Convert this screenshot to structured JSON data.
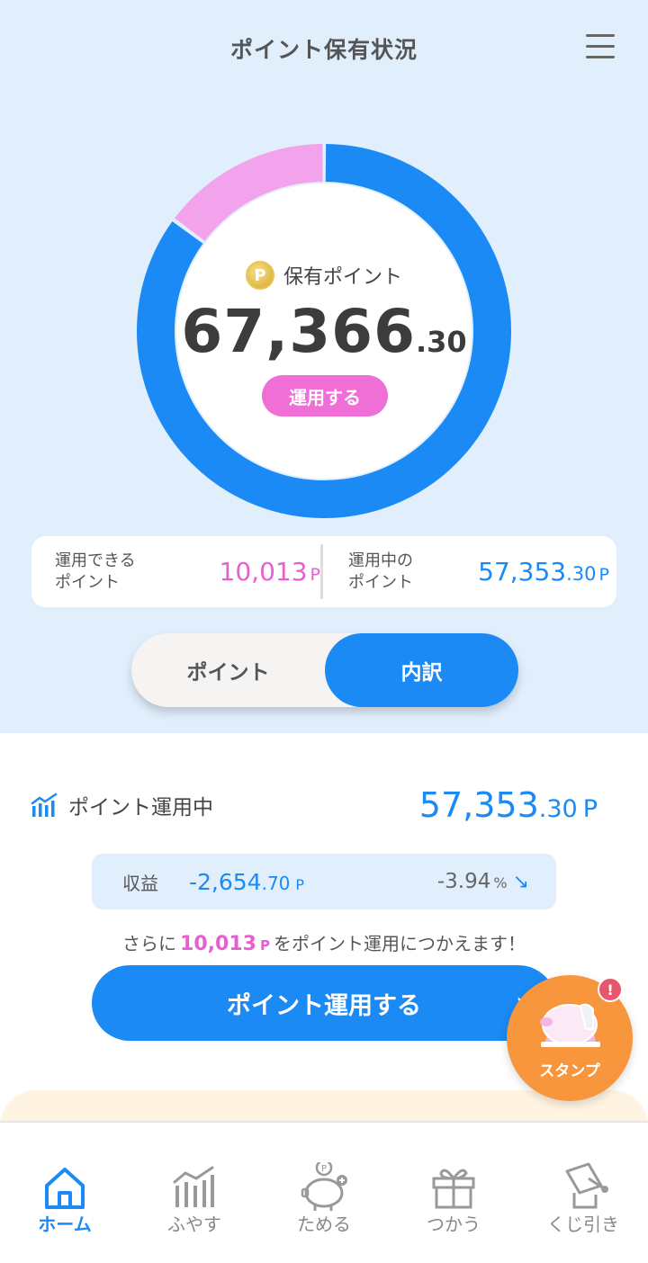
{
  "header": {
    "title": "ポイント保有状況",
    "menu_icon": "hamburger-menu-icon"
  },
  "holdings": {
    "label": "保有ポイント",
    "coin_symbol": "P",
    "amount_int": "67,366",
    "amount_dec": ".30",
    "invest_button": "運用する",
    "donut": {
      "available_fraction": 0.149,
      "invested_fraction": 0.851,
      "available_color": "#f3a3ec",
      "invested_color": "#1b8af5"
    }
  },
  "summary": {
    "available_label_1": "運用できる",
    "available_label_2": "ポイント",
    "available_value": "10,013",
    "available_unit": "P",
    "invested_label_1": "運用中の",
    "invested_label_2": "ポイント",
    "invested_value": "57,353",
    "invested_dec": ".30",
    "invested_unit": "P"
  },
  "toggle": {
    "left": "ポイント",
    "right": "内訳",
    "selected": "内訳"
  },
  "investment": {
    "title": "ポイント運用中",
    "icon": "chart-bars-icon",
    "total_int": "57,353",
    "total_dec": ".30",
    "total_unit": "P",
    "profit_label": "収益",
    "profit_int": "-2,654",
    "profit_dec": ".70",
    "profit_unit": "P",
    "profit_pct": "-3.94",
    "pct_unit": "%",
    "trend_icon": "arrow-down-right-icon"
  },
  "note": {
    "prefix": "さらに",
    "amount": "10,013",
    "unit": "P",
    "suffix": "をポイント運用につかえます！"
  },
  "cta": {
    "label": "ポイント運用する",
    "chevron": "›"
  },
  "stamp": {
    "label": "スタンプ",
    "badge": "!"
  },
  "nav": [
    {
      "label": "ホーム",
      "icon": "home-icon",
      "active": true
    },
    {
      "label": "ふやす",
      "icon": "grow-chart-icon",
      "active": false
    },
    {
      "label": "ためる",
      "icon": "piggy-bank-icon",
      "active": false
    },
    {
      "label": "つかう",
      "icon": "gift-icon",
      "active": false
    },
    {
      "label": "くじ引き",
      "icon": "lottery-machine-icon",
      "active": false
    }
  ],
  "colors": {
    "primary_blue": "#1b8af5",
    "pink": "#ea5fcf",
    "light_blue_bg": "#e1effd",
    "stamp_orange": "#f7963d"
  }
}
